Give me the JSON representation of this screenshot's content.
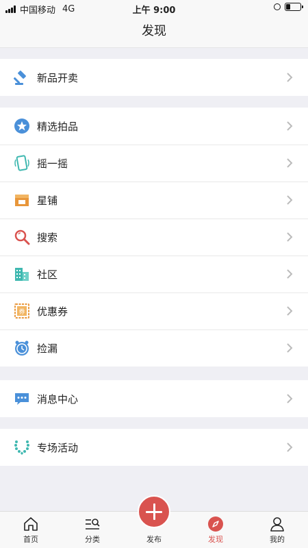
{
  "status_bar": {
    "carrier": "中国移动",
    "network": "4G",
    "time": "上午 9:00",
    "battery_level": 0.3
  },
  "nav": {
    "title": "发现"
  },
  "groups": [
    {
      "items": [
        {
          "label": "新品开卖",
          "icon": "gavel-icon"
        }
      ]
    },
    {
      "items": [
        {
          "label": "精选拍品",
          "icon": "star-badge-icon"
        },
        {
          "label": "摇一摇",
          "icon": "shake-phone-icon"
        },
        {
          "label": "星铺",
          "icon": "shop-icon"
        },
        {
          "label": "搜索",
          "icon": "search-icon"
        },
        {
          "label": "社区",
          "icon": "buildings-icon"
        },
        {
          "label": "优惠券",
          "icon": "coupon-icon"
        },
        {
          "label": "捡漏",
          "icon": "alarm-clock-icon"
        }
      ]
    },
    {
      "items": [
        {
          "label": "消息中心",
          "icon": "chat-bubble-icon"
        }
      ]
    },
    {
      "items": [
        {
          "label": "专场活动",
          "icon": "bead-necklace-icon"
        }
      ]
    }
  ],
  "tabbar": {
    "tabs": [
      {
        "label": "首页",
        "icon": "home-icon"
      },
      {
        "label": "分类",
        "icon": "category-search-icon"
      },
      {
        "label": "发布",
        "icon": "plus-icon"
      },
      {
        "label": "发现",
        "icon": "compass-icon",
        "active": true
      },
      {
        "label": "我的",
        "icon": "user-icon"
      }
    ]
  },
  "colors": {
    "accent": "#d9534f",
    "blue": "#4a90d9",
    "teal": "#3fb8b0",
    "orange": "#e8963a",
    "background": "#efeff4"
  }
}
